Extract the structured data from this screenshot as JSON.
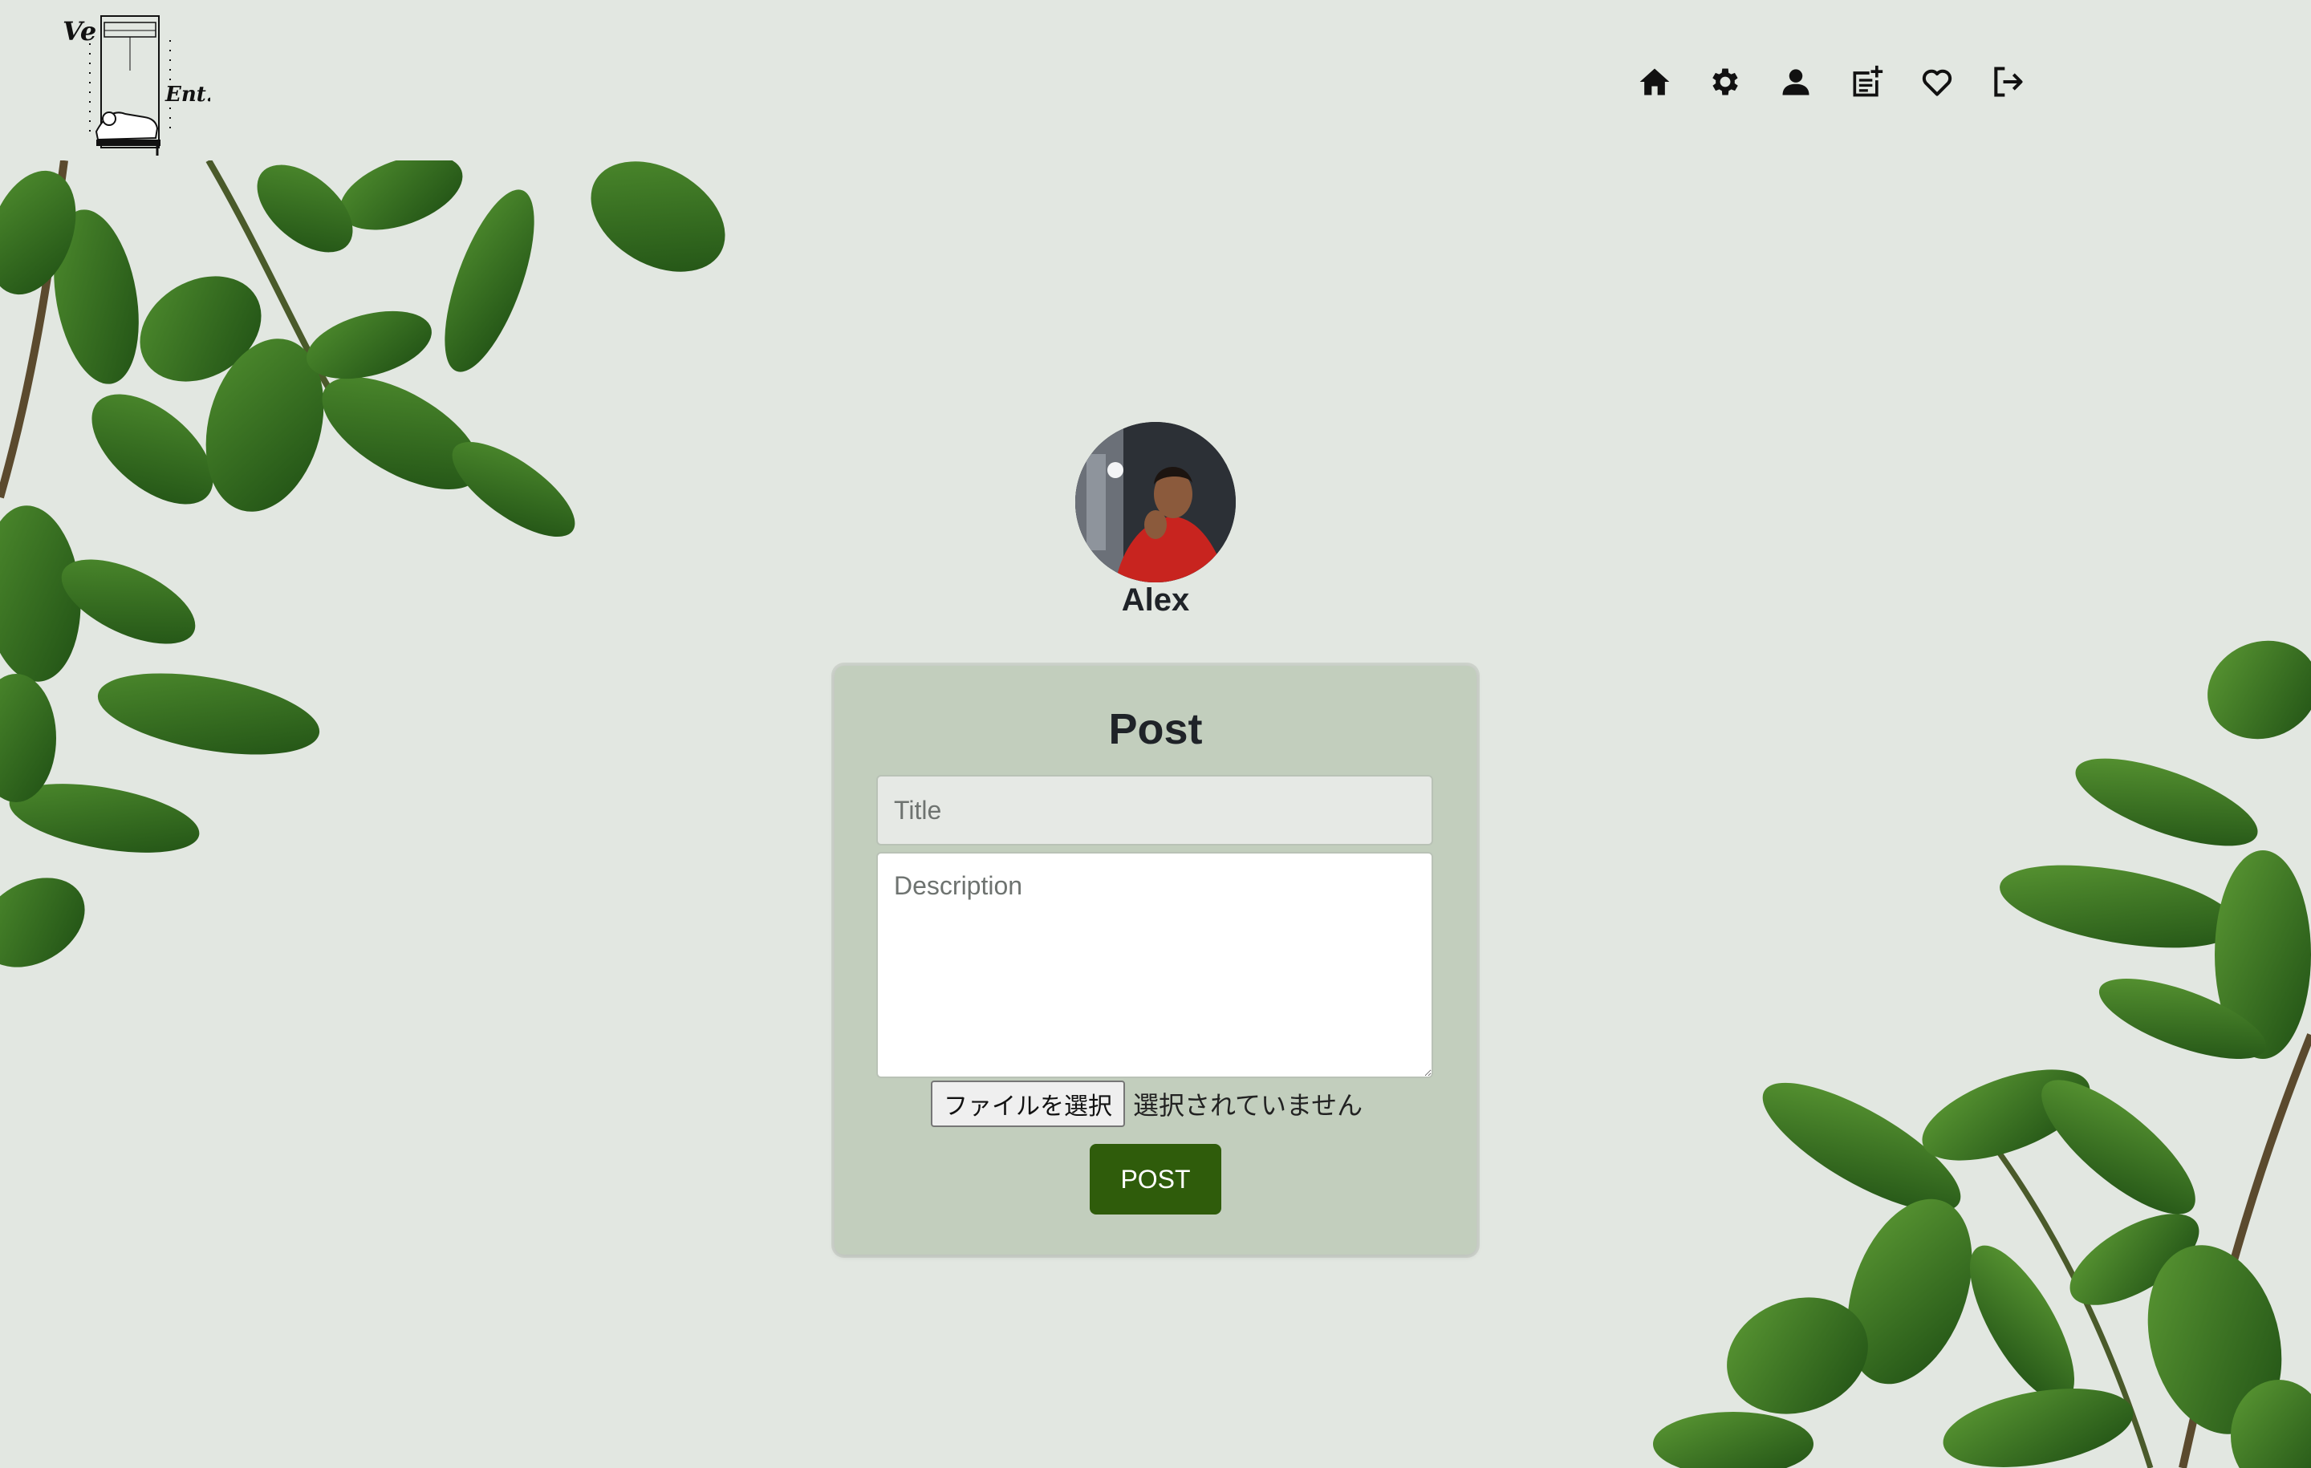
{
  "brand": {
    "logo_text_top": "Ve",
    "logo_text_bottom": "Ent."
  },
  "nav": [
    {
      "icon": "home-icon",
      "name": "nav-home"
    },
    {
      "icon": "gear-icon",
      "name": "nav-settings"
    },
    {
      "icon": "user-icon",
      "name": "nav-profile"
    },
    {
      "icon": "new-post-icon",
      "name": "nav-new-post"
    },
    {
      "icon": "heart-icon",
      "name": "nav-favorites"
    },
    {
      "icon": "logout-icon",
      "name": "nav-logout"
    }
  ],
  "profile": {
    "username": "Alex"
  },
  "form": {
    "heading": "Post",
    "title_placeholder": "Title",
    "title_value": "",
    "description_placeholder": "Description",
    "description_value": "",
    "file_button_label": "ファイルを選択",
    "file_status": "選択されていません",
    "submit_label": "POST"
  },
  "colors": {
    "background": "#e2e7e1",
    "card": "#c2cebd",
    "submit_button": "#2f5c0b",
    "icon": "#111111"
  }
}
